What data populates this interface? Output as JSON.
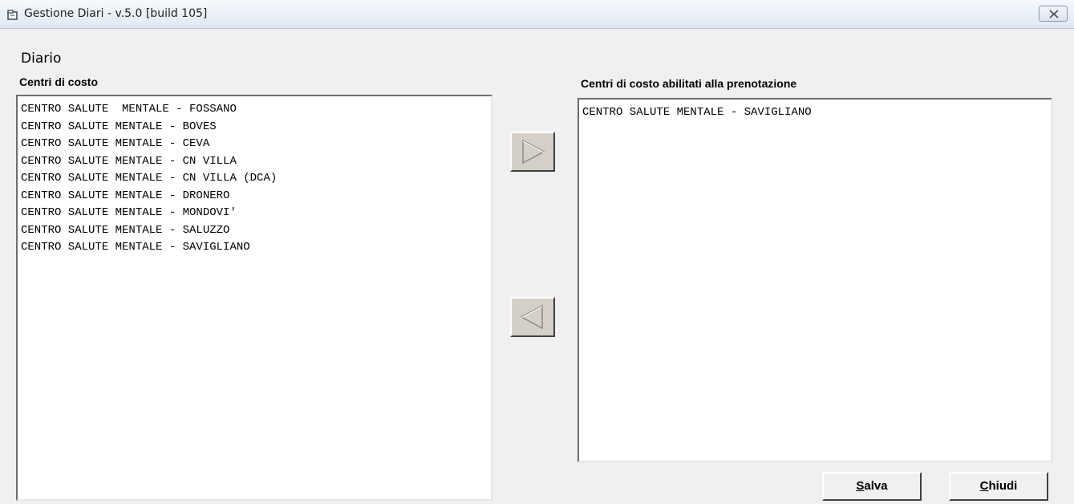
{
  "window": {
    "title": "Gestione Diari - v.5.0 [build 105]"
  },
  "section_title": "Diario",
  "left_panel": {
    "label": "Centri di costo",
    "items": [
      "CENTRO SALUTE  MENTALE - FOSSANO",
      "CENTRO SALUTE MENTALE - BOVES",
      "CENTRO SALUTE MENTALE - CEVA",
      "CENTRO SALUTE MENTALE - CN VILLA",
      "CENTRO SALUTE MENTALE - CN VILLA (DCA)",
      "CENTRO SALUTE MENTALE - DRONERO",
      "CENTRO SALUTE MENTALE - MONDOVI'",
      "CENTRO SALUTE MENTALE - SALUZZO",
      "CENTRO SALUTE MENTALE - SAVIGLIANO"
    ]
  },
  "right_panel": {
    "label": "Centri di costo abilitati alla prenotazione",
    "items": [
      "CENTRO SALUTE MENTALE - SAVIGLIANO"
    ]
  },
  "buttons": {
    "add_icon": "triangle-right-icon",
    "remove_icon": "triangle-left-icon",
    "save": {
      "mnemonic": "S",
      "rest": "alva"
    },
    "close": {
      "mnemonic": "C",
      "rest": "hiudi"
    }
  },
  "colors": {
    "window_bg": "#f0f0f0",
    "list_bg": "#ffffff",
    "button_face": "#d4d0c8"
  }
}
